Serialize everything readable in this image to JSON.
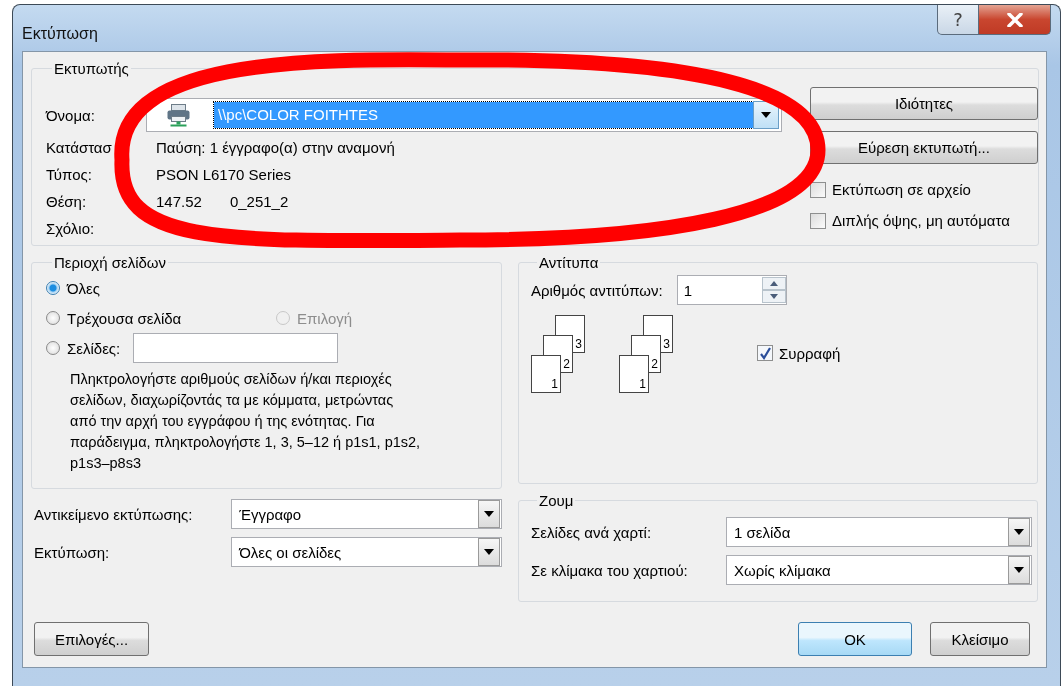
{
  "window": {
    "title": "Εκτύπωση"
  },
  "title_buttons": [
    {
      "kind": "help",
      "label": "?"
    },
    {
      "kind": "close"
    }
  ],
  "printer": {
    "legend": "Εκτυπωτής",
    "name_label": "Όνομα:",
    "name_value": "\\\\pc\\COLOR FOITHTES",
    "name_selected": true,
    "info": [
      {
        "label": "Κατάστασ",
        "value": "Παύση: 1 έγγραφο(α) στην αναμονή"
      },
      {
        "label": "Τύπος:",
        "value": "PSON L6170 Series"
      },
      {
        "label": "Θέση:",
        "value": "147.52",
        "value_2": "0_251_2"
      },
      {
        "label": "Σχόλιο:"
      }
    ],
    "buttons": [
      "Ιδιότητες",
      "Εύρεση εκτυπωτή..."
    ],
    "checkboxes": [
      {
        "label": "Εκτύπωση σε αρχείο",
        "checked": false
      },
      {
        "label": "Διπλής όψης, μη αυτόματα",
        "checked": false
      }
    ]
  },
  "page_range": {
    "legend": "Περιοχή σελίδων",
    "options": [
      {
        "label": "Όλες",
        "selected": true,
        "disabled": false
      },
      {
        "label": "Τρέχουσα σελίδα",
        "selected": false,
        "disabled": false
      },
      {
        "label": "Επιλογή",
        "selected": false,
        "disabled": true
      },
      {
        "label": "Σελίδες:",
        "selected": false,
        "disabled": false
      }
    ],
    "hint": "Πληκτρολογήστε αριθμούς σελίδων ή/και περιοχές\nσελίδων, διαχωρίζοντάς τα με κόμματα, μετρώντας\nαπό την αρχή του εγγράφου ή της ενότητας. Για\nπαράδειγμα, πληκτρολογήστε 1, 3, 5–12 ή p1s1, p1s2,\np1s3–p8s3"
  },
  "copies": {
    "legend": "Αντίτυπα",
    "count_label": "Αριθμός αντιτύπων:",
    "count_value": "1",
    "stacks": [
      {
        "pages": [
          "1",
          "2",
          "3"
        ]
      },
      {
        "pages": [
          "1",
          "2",
          "3"
        ]
      }
    ],
    "collate": {
      "label": "Συρραφή",
      "checked": true
    }
  },
  "print_settings": [
    {
      "label": "Αντικείμενο εκτύπωσης:",
      "value": "Έγγραφο"
    },
    {
      "label": "Εκτύπωση:",
      "value": "Όλες οι σελίδες"
    }
  ],
  "zoom": {
    "legend": "Ζουμ",
    "settings": [
      {
        "label": "Σελίδες ανά χαρτί:",
        "value": "1 σελίδα"
      },
      {
        "label": "Σε κλίμακα του χαρτιού:",
        "value": "Χωρίς κλίμακα"
      }
    ]
  },
  "buttons": [
    {
      "label": "Επιλογές...",
      "kind": "options"
    },
    {
      "label": "OK",
      "kind": "default"
    },
    {
      "label": "Κλείσιμο",
      "kind": "normal"
    }
  ],
  "annotation": {
    "kind": "ellipse"
  }
}
